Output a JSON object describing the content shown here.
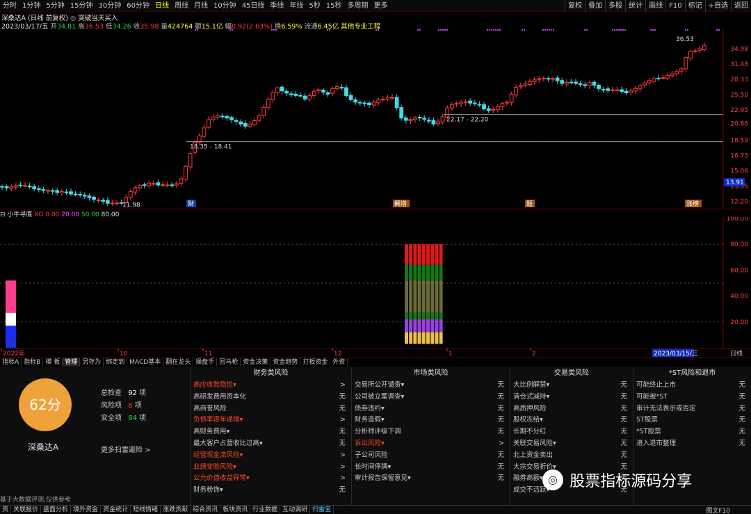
{
  "toolbar": {
    "periods": [
      "分时",
      "1分钟",
      "5分钟",
      "15分钟",
      "30分钟",
      "60分钟",
      "日线",
      "周线",
      "月线",
      "10分钟",
      "45日线",
      "季线",
      "年线",
      "5秒",
      "15秒",
      "多周期",
      "更多"
    ],
    "active_period": "日线",
    "right_buttons": [
      "复权",
      "叠加",
      "多股",
      "统计",
      "画线",
      "F10",
      "标记",
      "+自选",
      "返回"
    ]
  },
  "header": {
    "stock_title": "深桑达A (日线 前复权)",
    "signal": "突破当天买入",
    "date": "2023/03/17/五",
    "open_label": "开",
    "open": "34.81",
    "high_label": "高",
    "high": "36.53",
    "low_label": "低",
    "low": "34.26",
    "close_label": "收",
    "close": "35.98",
    "volume_label": "量",
    "volume": "424764",
    "amount_label": "额",
    "amount": "15.1亿",
    "change_label": "幅",
    "change": "0.92(2.63%)",
    "turnover_label": "换",
    "turnover": "6.59%",
    "float_label": "流通",
    "float_cap": "6.45亿",
    "sector": "其他专业工程"
  },
  "price_axis": [
    "34.98",
    "31.48",
    "28.33",
    "25.50",
    "22.95",
    "20.86",
    "18.59",
    "16.73",
    "15.06",
    "13.55",
    "12.20"
  ],
  "current_price_tag": "13.91",
  "annotations": {
    "high_mark": "36.53",
    "low_mark": "11.98",
    "support1": "18.35 - 18.41",
    "support2": "22.17 - 22.20"
  },
  "event_tags": [
    "财",
    "概增",
    "题",
    "涨榜"
  ],
  "indicator": {
    "name": "小牛寻底",
    "xg_label": "XG",
    "xg_value": "0.00",
    "levels": [
      "20.00",
      "50.00",
      "80.00"
    ],
    "axis": [
      "100.00",
      "80.00",
      "60.00",
      "40.00",
      "20.00"
    ]
  },
  "time_axis": [
    "2022年",
    "10",
    "11",
    "12",
    "1",
    "2"
  ],
  "time_axis_current": "2023/03/15/三",
  "time_axis_right": "日线",
  "bottom_tabs": [
    "指标A",
    "指标B",
    "模 板",
    "管理",
    "另存为",
    "绑定到",
    "MACD基本",
    "翻在龙头",
    "操盘手",
    "回马枪",
    "资金决策",
    "资金趋势",
    "打板资金",
    "外资"
  ],
  "bottom_active": "管理",
  "score": {
    "value": "62分",
    "total_label": "总检查",
    "total": "92",
    "total_unit": "项",
    "risk_label": "风险项",
    "risk": "8",
    "risk_unit": "项",
    "safe_label": "安全项",
    "safe": "84",
    "safe_unit": "项",
    "stock_name": "深桑达A",
    "more_link": "更多扫雷避险 >",
    "footnote": "基于大数据评测,仅供参考"
  },
  "risk_columns": [
    {
      "title": "财务类风险",
      "rows": [
        {
          "label": "高应收款隐忧▾",
          "value": ">",
          "warn": true
        },
        {
          "label": "高研发费用资本化",
          "value": "无",
          "warn": false
        },
        {
          "label": "高商誉风险",
          "value": "无",
          "warn": false
        },
        {
          "label": "负债率逐年递增▾",
          "value": ">",
          "warn": true
        },
        {
          "label": "高财务费用▾",
          "value": "无",
          "warn": false
        },
        {
          "label": "最大客户占营收比过高▾",
          "value": "无",
          "warn": false
        },
        {
          "label": "经营现金流风险▾",
          "value": ">",
          "warn": true
        },
        {
          "label": "业绩变脸风险▾",
          "value": ">",
          "warn": true
        },
        {
          "label": "公允价值收益异常▾",
          "value": ">",
          "warn": true
        },
        {
          "label": "财务粉饰▾",
          "value": "无",
          "warn": false
        }
      ]
    },
    {
      "title": "市场类风险",
      "rows": [
        {
          "label": "交易所公开谴责▾",
          "value": "无",
          "warn": false
        },
        {
          "label": "公司被立案调查▾",
          "value": "无",
          "warn": false
        },
        {
          "label": "债券违约▾",
          "value": "无",
          "warn": false
        },
        {
          "label": "财务造假▾",
          "value": "无",
          "warn": false
        },
        {
          "label": "分析师评级下调",
          "value": "无",
          "warn": false
        },
        {
          "label": "诉讼风险▾",
          "value": ">",
          "warn": true
        },
        {
          "label": "子公司风险",
          "value": "无",
          "warn": false
        },
        {
          "label": "长时间停牌▾",
          "value": "无",
          "warn": false
        },
        {
          "label": "审计报告保留意见▾",
          "value": "无",
          "warn": false
        }
      ]
    },
    {
      "title": "交易类风险",
      "rows": [
        {
          "label": "大比例解禁▾",
          "value": "无",
          "warn": false
        },
        {
          "label": "清仓式减持▾",
          "value": "无",
          "warn": false
        },
        {
          "label": "高质押风险",
          "value": "无",
          "warn": false
        },
        {
          "label": "股权冻结▾",
          "value": "无",
          "warn": false
        },
        {
          "label": "长期不分红",
          "value": "无",
          "warn": false
        },
        {
          "label": "关联交易风险▾",
          "value": "无",
          "warn": false
        },
        {
          "label": "北上资金卖出",
          "value": "无",
          "warn": false
        },
        {
          "label": "大宗交易折价▾",
          "value": "无",
          "warn": false
        },
        {
          "label": "融券高额▾",
          "value": "无",
          "warn": false
        },
        {
          "label": "成交不活跃▾",
          "value": "无",
          "warn": false
        }
      ]
    },
    {
      "title": "*ST风险和退市",
      "rows": [
        {
          "label": "可能终止上市",
          "value": "无",
          "warn": false
        },
        {
          "label": "可能被*ST",
          "value": "无",
          "warn": false
        },
        {
          "label": "审计无法表示或否定",
          "value": "无",
          "warn": false
        },
        {
          "label": "ST股票",
          "value": "无",
          "warn": false
        },
        {
          "label": "*ST股票",
          "value": "无",
          "warn": false
        },
        {
          "label": "进入退市整理",
          "value": "无",
          "warn": false
        }
      ]
    }
  ],
  "status_bar": [
    "资",
    "关联报价",
    "盘面分析",
    "境外资金",
    "资金统计",
    "短线情绪",
    "涨跌贡献",
    "综合资讯",
    "板块资讯",
    "行业数据",
    "互动调研",
    "扫雷宝"
  ],
  "status_active": "扫雷宝",
  "status_right": "图文F10",
  "watermark": "股票指标源码分享",
  "colors": {
    "up": "#ff3a3a",
    "down": "#46d8e8",
    "accent": "#ffff00",
    "score_circle": "#f0a23a"
  }
}
